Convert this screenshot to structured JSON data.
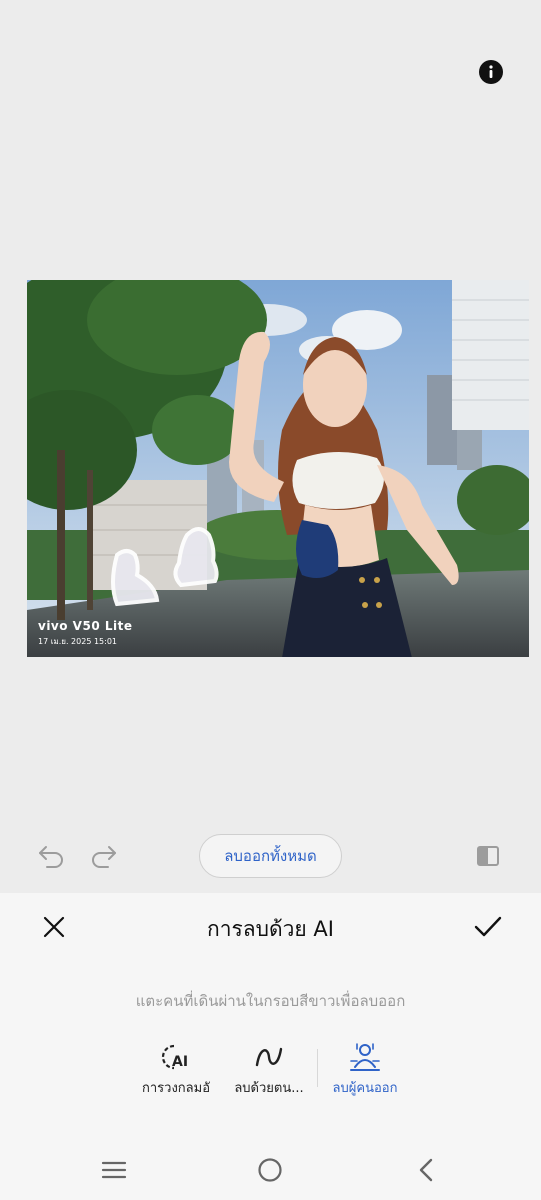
{
  "viewer": {
    "info_icon": "info-icon",
    "watermark": {
      "brand": "vivo V50 Lite",
      "datetime": "17 เม.ย. 2025 15:01"
    }
  },
  "edit_bar": {
    "undo_icon": "undo-icon",
    "redo_icon": "redo-icon",
    "clear_all_label": "ลบออกทั้งหมด",
    "compare_icon": "compare-icon"
  },
  "panel": {
    "title": "การลบด้วย AI",
    "cancel_icon": "close-icon",
    "confirm_icon": "check-icon",
    "hint": "แตะคนที่เดินผ่านในกรอบสีขาวเพื่อลบออก",
    "modes": [
      {
        "label": "การวงกลมอั",
        "icon": "ai-circle-icon",
        "active": false
      },
      {
        "label": "ลบด้วยตน...",
        "icon": "brush-stroke-icon",
        "active": false
      },
      {
        "label": "ลบผู้คนออก",
        "icon": "remove-people-icon",
        "active": true
      }
    ]
  },
  "colors": {
    "accent": "#2f63c8",
    "background": "#ececec",
    "panel_background": "#f6f6f6"
  },
  "navbar": {
    "menu_icon": "menu-icon",
    "home_icon": "home-icon",
    "back_icon": "back-icon"
  }
}
